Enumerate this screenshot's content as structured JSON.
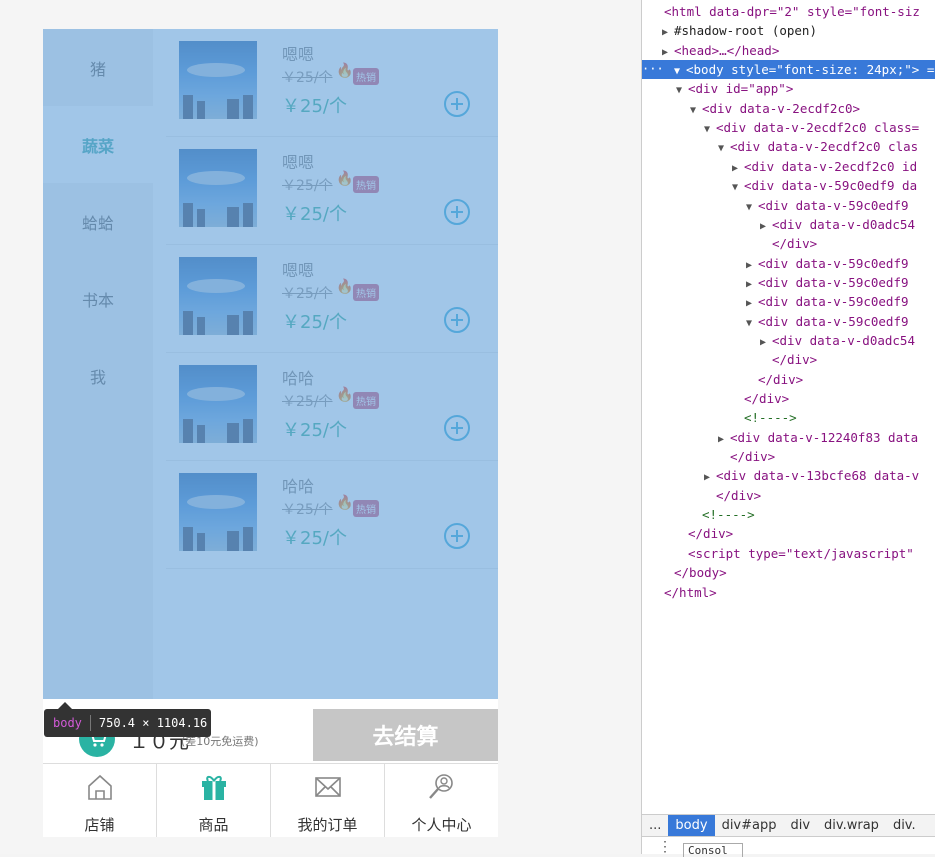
{
  "categories": [
    {
      "label": "猪",
      "active": false
    },
    {
      "label": "蔬菜",
      "active": true
    },
    {
      "label": "蛤蛤",
      "active": false
    },
    {
      "label": "书本",
      "active": false
    },
    {
      "label": "我",
      "active": false
    }
  ],
  "goods": [
    {
      "name": "嗯嗯",
      "old_price": "￥25/个",
      "badge": "热销",
      "price": "￥25/个"
    },
    {
      "name": "嗯嗯",
      "old_price": "￥25/个",
      "badge": "热销",
      "price": "￥25/个"
    },
    {
      "name": "嗯嗯",
      "old_price": "￥25/个",
      "badge": "热销",
      "price": "￥25/个"
    },
    {
      "name": "哈哈",
      "old_price": "￥25/个",
      "badge": "热销",
      "price": "￥25/个"
    },
    {
      "name": "哈哈",
      "old_price": "￥25/个",
      "badge": "热销",
      "price": "￥25/个"
    }
  ],
  "cart": {
    "total": "１０元",
    "note": "(差10元免运费)",
    "checkout": "去结算"
  },
  "tabs": [
    {
      "label": "店铺",
      "icon": "shop-icon"
    },
    {
      "label": "商品",
      "icon": "gift-icon"
    },
    {
      "label": "我的订单",
      "icon": "envelope-icon"
    },
    {
      "label": "个人中心",
      "icon": "user-search-icon"
    }
  ],
  "tooltip": {
    "tag": "body",
    "size": "750.4 × 1104.16"
  },
  "devtools": {
    "lines": [
      {
        "arrow": "",
        "html": "<html data-dpr=\"2\" style=\"font-siz"
      },
      {
        "arrow": "▶",
        "html": "#shadow-root (open)"
      },
      {
        "arrow": "▶",
        "html": "<head>…</head>"
      },
      {
        "arrow": "▼",
        "html": "<body style=\"font-size: 24px;\"> =="
      },
      {
        "arrow": "▼",
        "html": "<div id=\"app\">"
      },
      {
        "arrow": "▼",
        "html": "<div data-v-2ecdf2c0>"
      },
      {
        "arrow": "▼",
        "html": "<div data-v-2ecdf2c0 class="
      },
      {
        "arrow": "▼",
        "html": "<div data-v-2ecdf2c0 clas"
      },
      {
        "arrow": "▶",
        "html": "<div data-v-2ecdf2c0 id"
      },
      {
        "arrow": "▼",
        "html": "<div data-v-59c0edf9 da"
      },
      {
        "arrow": "▼",
        "html": "<div data-v-59c0edf9"
      },
      {
        "arrow": "▶",
        "html": "<div data-v-d0adc54"
      },
      {
        "arrow": "",
        "html": "</div>"
      },
      {
        "arrow": "▶",
        "html": "<div data-v-59c0edf9"
      },
      {
        "arrow": "▶",
        "html": "<div data-v-59c0edf9"
      },
      {
        "arrow": "▶",
        "html": "<div data-v-59c0edf9"
      },
      {
        "arrow": "▼",
        "html": "<div data-v-59c0edf9"
      },
      {
        "arrow": "▶",
        "html": "<div data-v-d0adc54"
      },
      {
        "arrow": "",
        "html": "</div>"
      },
      {
        "arrow": "",
        "html": "</div>"
      },
      {
        "arrow": "",
        "html": "</div>"
      },
      {
        "arrow": "",
        "html": "<!---->"
      },
      {
        "arrow": "▶",
        "html": "<div data-v-12240f83 data"
      },
      {
        "arrow": "",
        "html": "</div>"
      },
      {
        "arrow": "▶",
        "html": "<div data-v-13bcfe68 data-v"
      },
      {
        "arrow": "",
        "html": "</div>"
      },
      {
        "arrow": "",
        "html": "<!---->"
      },
      {
        "arrow": "",
        "html": "</div>"
      },
      {
        "arrow": "",
        "html": "<script type=\"text/javascript\""
      },
      {
        "arrow": "",
        "html": "</body>"
      },
      {
        "arrow": "",
        "html": "</html>"
      }
    ],
    "crumbs": [
      "...",
      "body",
      "div#app",
      "div",
      "div.wrap",
      "div."
    ],
    "console_label": "Consol",
    "dots": "···"
  }
}
